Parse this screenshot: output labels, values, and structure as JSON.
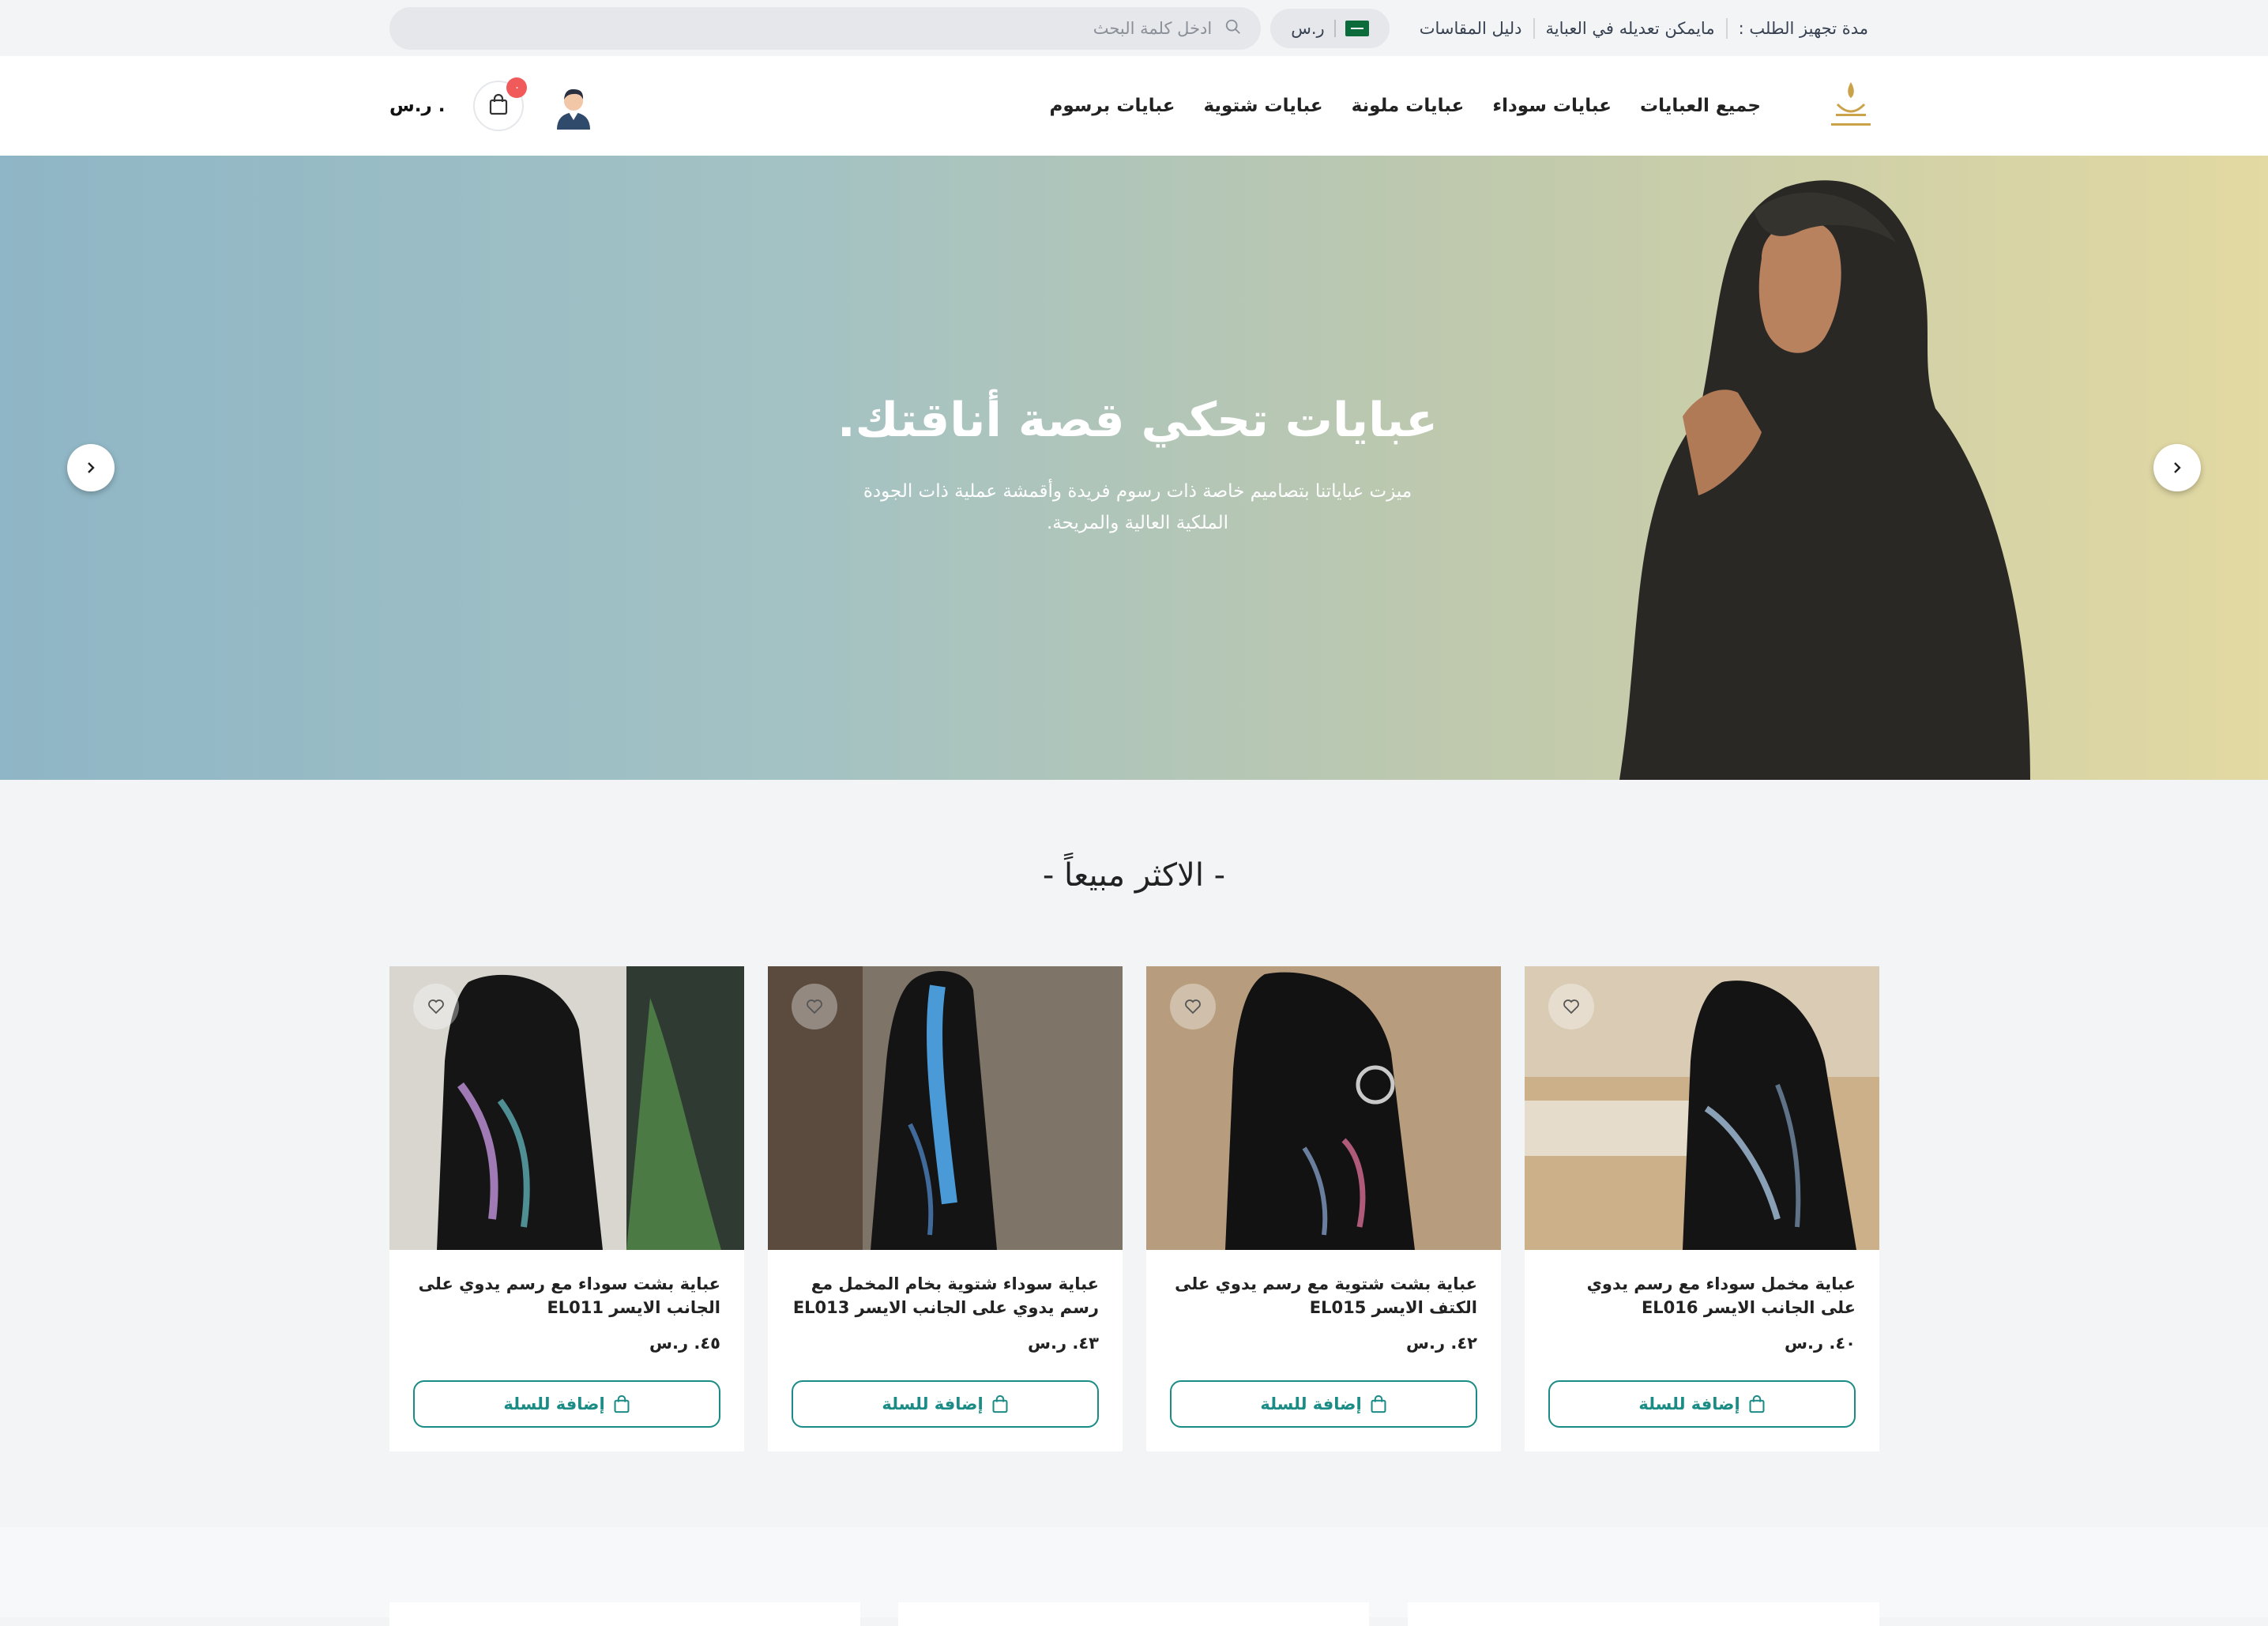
{
  "topbar": {
    "prep_label": "مدة تجهيز الطلب :",
    "modify_label": "مايمكن تعديله في العباية",
    "sizes_label": "دليل المقاسات",
    "currency": "ر.س",
    "search_placeholder": "ادخل كلمة البحث"
  },
  "header": {
    "nav": [
      "جميع العبايات",
      "عبايات سوداء",
      "عبايات ملونة",
      "عبايات شتوية",
      "عبايات برسوم"
    ],
    "cart_count": "٠",
    "cart_total": ". ر.س"
  },
  "hero": {
    "title": "عبايات تحكي قصة أناقتك.",
    "subtitle": "ميزت عباياتنا بتصاميم خاصة ذات رسوم فريدة وأقمشة عملية ذات الجودة الملكية العالية والمريحة."
  },
  "best_sellers": {
    "title": "- الاكثر مبيعاً -",
    "add_label": "إضافة للسلة",
    "products": [
      {
        "name": "عباية مخمل سوداء مع رسم يدوي على الجانب الايسر EL016",
        "price": "٤٠. ر.س"
      },
      {
        "name": "عباية بشت شتوية مع رسم يدوي على الكتف الايسر EL015",
        "price": "٤٢. ر.س"
      },
      {
        "name": "عباية سوداء شتوية بخام المخمل مع رسم يدوي على الجانب الايسر EL013",
        "price": "٤٣. ر.س"
      },
      {
        "name": "عباية بشت سوداء مع رسم يدوي على الجانب الايسر EL011",
        "price": "٤٥. ر.س"
      }
    ]
  },
  "colors": {
    "accent": "#1b8c85",
    "badge": "#f05a5a",
    "logo_gold": "#c9a24a"
  },
  "icons": {
    "search": "search-icon",
    "cart": "bag-icon",
    "wishlist": "heart-icon",
    "user": "user-avatar-icon"
  }
}
